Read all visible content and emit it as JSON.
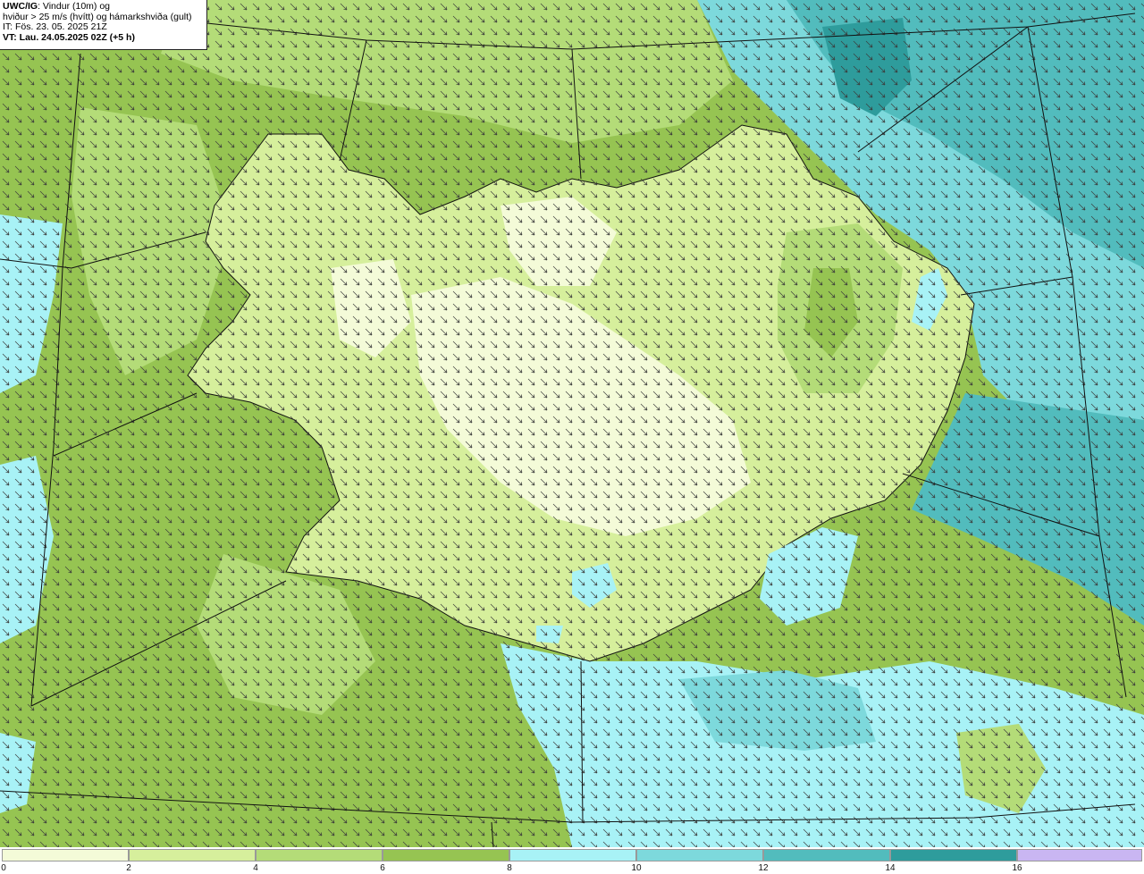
{
  "info": {
    "line1_bold": "UWC/IG",
    "line1_rest": ": Vindur (10m) og",
    "line2": "hviður > 25 m/s (hvítt) og hámarkshviða (gult)",
    "line3": "IT: Fös. 23. 05. 2025 21Z",
    "line4": "VT: Lau. 24.05.2025 02Z (+5 h)"
  },
  "legend": {
    "ticks": [
      "0",
      "2",
      "4",
      "6",
      "8",
      "10",
      "12",
      "14",
      "16"
    ],
    "colors": [
      "#f4fbd8",
      "#d6ef9c",
      "#b4dc78",
      "#96c452",
      "#a8f2f6",
      "#7dd9dc",
      "#52bcbd",
      "#2e9c9c",
      "#c9b6f2"
    ]
  },
  "map": {
    "sea_colors": {
      "calm": "#96c452",
      "mid": "#a8f2f6",
      "strong": "#2e9c9c"
    },
    "land_color": "#d6ef9c"
  }
}
